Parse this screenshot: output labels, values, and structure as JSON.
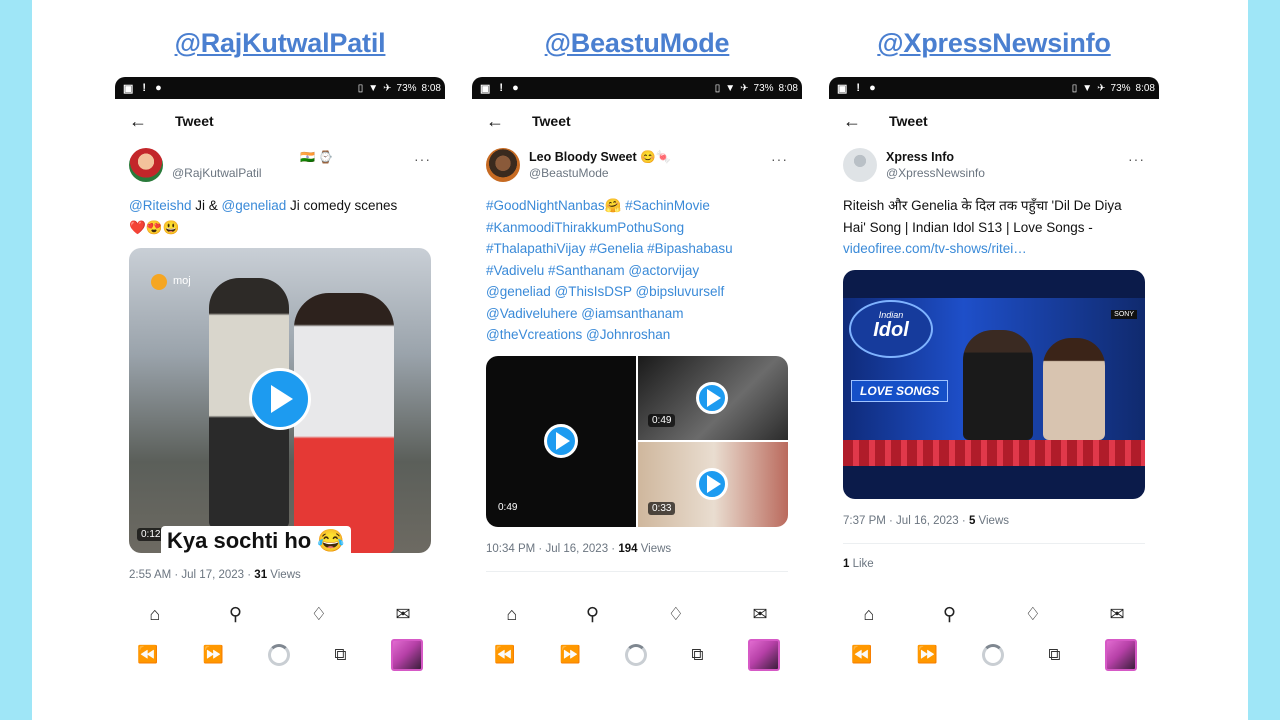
{
  "columns": [
    {
      "handle": "@RajKutwalPatil",
      "status": {
        "battery": "73%",
        "time": "8:08"
      },
      "header_title": "Tweet",
      "author": {
        "display_name": "",
        "username": "@RajKutwalPatil",
        "badges": "🇮🇳 ⌚"
      },
      "text_link1": "@Riteishd",
      "text_mid": " Ji & ",
      "text_link2": "@geneliad",
      "text_end": " Ji comedy scenes",
      "emojis": "❤️😍😃",
      "media": {
        "duration": "0:12",
        "caption": "Kya sochti ho 😂",
        "watermark": "moj"
      },
      "timestamp": "2:55 AM · Jul 17, 2023 · ",
      "views_count": "31",
      "views_label": " Views"
    },
    {
      "handle": "@BeastuMode",
      "status": {
        "battery": "73%",
        "time": "8:08"
      },
      "header_title": "Tweet",
      "author": {
        "display_name": "Leo Bloody Sweet 😊🍬",
        "username": "@BeastuMode"
      },
      "hashtags": [
        "#GoodNightNanbas🤗 #SachinMovie",
        "#KanmoodiThirakkumPothuSong",
        "#ThalapathiVijay #Genelia #Bipashabasu",
        "#Vadivelu #Santhanam @actorvijay",
        "@geneliad @ThisIsDSP @bipsluvurself",
        "@Vadiveluhere @iamsanthanam",
        "@theVcreations @Johnroshan"
      ],
      "media": {
        "duration_main": "0:49",
        "duration_top": "0:49",
        "duration_bottom": "0:33"
      },
      "timestamp": "10:34 PM · Jul 16, 2023 · ",
      "views_count": "194",
      "views_label": " Views"
    },
    {
      "handle": "@XpressNewsinfo",
      "status": {
        "battery": "73%",
        "time": "8:08"
      },
      "header_title": "Tweet",
      "author": {
        "display_name": "Xpress Info",
        "username": "@XpressNewsinfo"
      },
      "text_line1": "Riteish और Genelia के दिल तक पहुँचा 'Dil De Diya",
      "text_line2": "Hai' Song | Indian Idol S13 | Love Songs -",
      "text_link": "videofiree.com/tv-shows/ritei…",
      "media": {
        "logo_line1": "Indian",
        "logo_line2": "Idol",
        "banner": "LOVE SONGS",
        "channel": "SONY"
      },
      "timestamp": "7:37 PM · Jul 16, 2023 · ",
      "views_count": "5",
      "views_label": " Views",
      "likes": "1",
      "likes_label": " Like"
    }
  ],
  "icons": {
    "nav": [
      "home-icon",
      "search-icon",
      "bell-icon",
      "mail-icon"
    ],
    "system": [
      "rewind-icon",
      "forward-icon",
      "loading-icon",
      "tabs-icon",
      "media-thumbnail"
    ]
  },
  "colors": {
    "background": "#9fe6f7",
    "handle": "#4a7fd0",
    "link": "#3a8ad8",
    "play": "#1d9bf0"
  }
}
